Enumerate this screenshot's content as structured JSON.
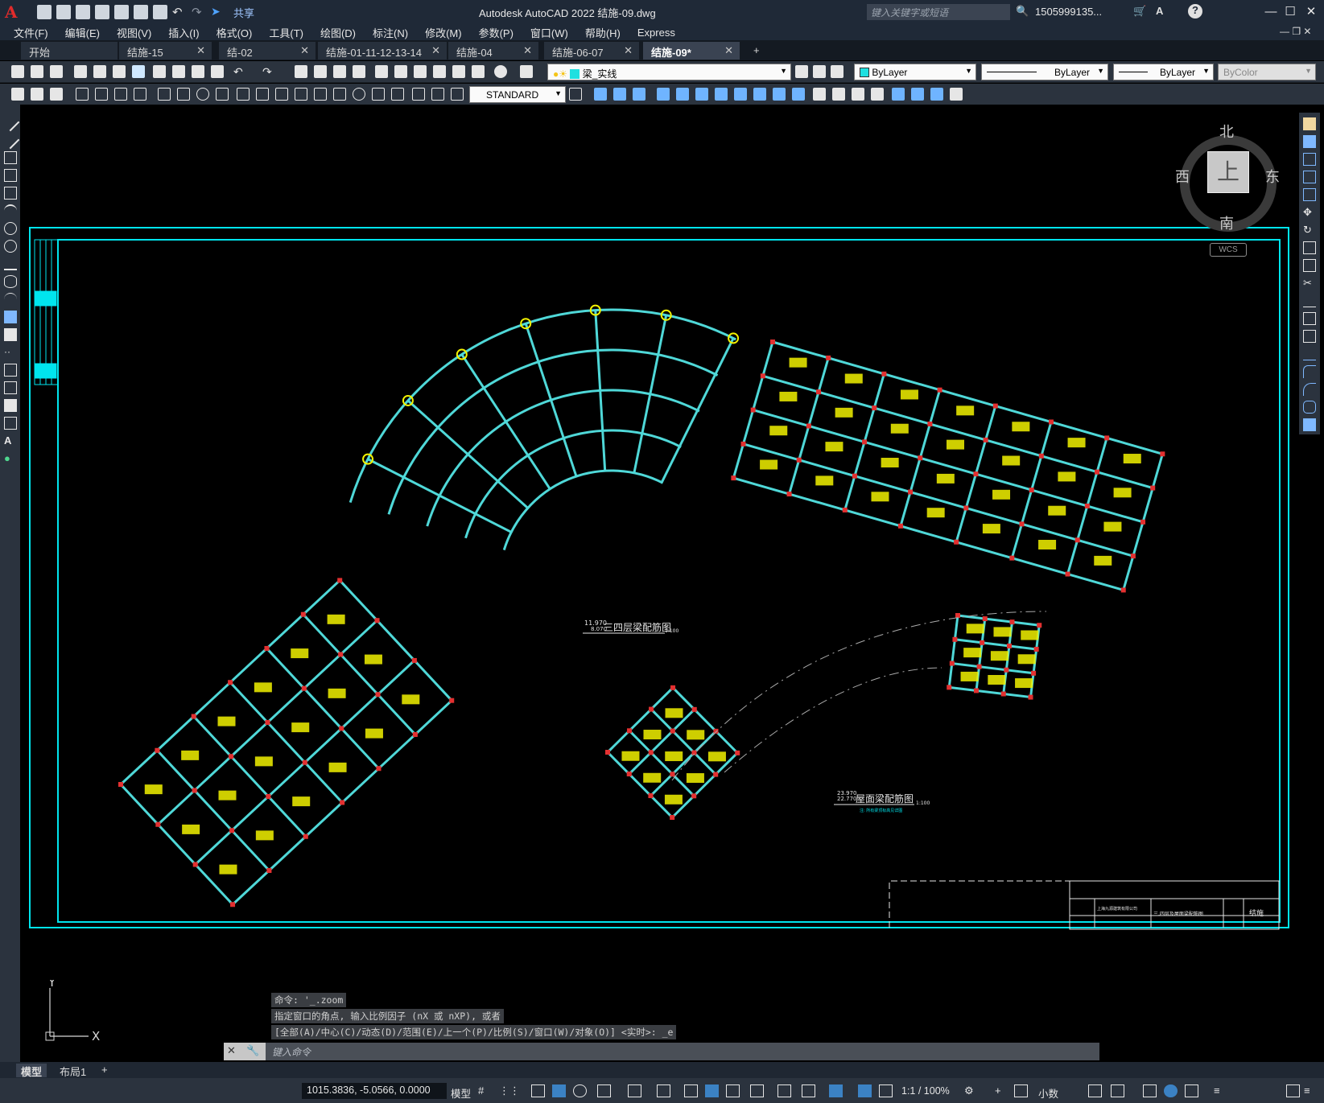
{
  "app": {
    "logo": "A",
    "title": "Autodesk AutoCAD 2022    结施-09.dwg",
    "share_label": "共享",
    "search_placeholder": "键入关键字或短语",
    "user": "1505999135...",
    "win_min": "—",
    "win_max": "☐",
    "win_close": "✕"
  },
  "menu": [
    "文件(F)",
    "编辑(E)",
    "视图(V)",
    "插入(I)",
    "格式(O)",
    "工具(T)",
    "绘图(D)",
    "标注(N)",
    "修改(M)",
    "参数(P)",
    "窗口(W)",
    "帮助(H)",
    "Express"
  ],
  "tabs": [
    {
      "label": "开始",
      "closable": false
    },
    {
      "label": "结施-15",
      "closable": true
    },
    {
      "label": "结-02",
      "closable": true
    },
    {
      "label": "结施-01-11-12-13-14",
      "closable": true
    },
    {
      "label": "结施-04",
      "closable": true
    },
    {
      "label": "结施-06-07",
      "closable": true
    },
    {
      "label": "结施-09*",
      "closable": true,
      "active": true
    }
  ],
  "tab_add": "+",
  "tab_close": "✕",
  "properties": {
    "layer": "梁_实线",
    "color": "ByLayer",
    "linetype": "ByLayer",
    "lineweight": "ByLayer",
    "plotstyle": "ByColor",
    "textstyle": "STANDARD",
    "layer_color": "#1fe0e0",
    "color_swatch": "#1fe0e0"
  },
  "viewcube": {
    "north": "北",
    "south": "南",
    "east": "东",
    "west": "西",
    "top": "上",
    "wcs": "WCS"
  },
  "drawing": {
    "label_upper": "三四层梁配筋图",
    "label_upper_level": "11.970",
    "label_upper_level2": "8.070",
    "label_upper_scale": "1:100",
    "label_roof": "屋面梁配筋图",
    "label_roof_level": "23.970",
    "label_roof_level2": "22.770",
    "label_roof_scale": "1:100",
    "label_roof_note": "注: 所有梁顶标高见详图",
    "frame_color": "#00e5ee",
    "beam_color": "#4fd8d8",
    "annotation_color": "#f2f200",
    "column_color": "#e33030",
    "title_block_company": "上海九源建筑有限公司",
    "title_block_drawing": "三,四层及屋面梁配筋图",
    "title_block_code": "结施"
  },
  "command": {
    "line1": "命令: '_.zoom",
    "line2": "指定窗口的角点, 输入比例因子 (nX 或 nXP), 或者",
    "line3": "[全部(A)/中心(C)/动态(D)/范围(E)/上一个(P)/比例(S)/窗口(W)/对象(O)] <实时>: _e",
    "placeholder": "键入命令"
  },
  "layout_tabs": [
    {
      "label": "模型",
      "active": true
    },
    {
      "label": "布局1",
      "active": false
    }
  ],
  "layout_add": "+",
  "status": {
    "coords": "1015.3836, -5.0566, 0.0000",
    "model": "模型",
    "scale": "1:1 / 100%",
    "units": "小数"
  },
  "ucs": {
    "x": "X",
    "y": "Y"
  }
}
